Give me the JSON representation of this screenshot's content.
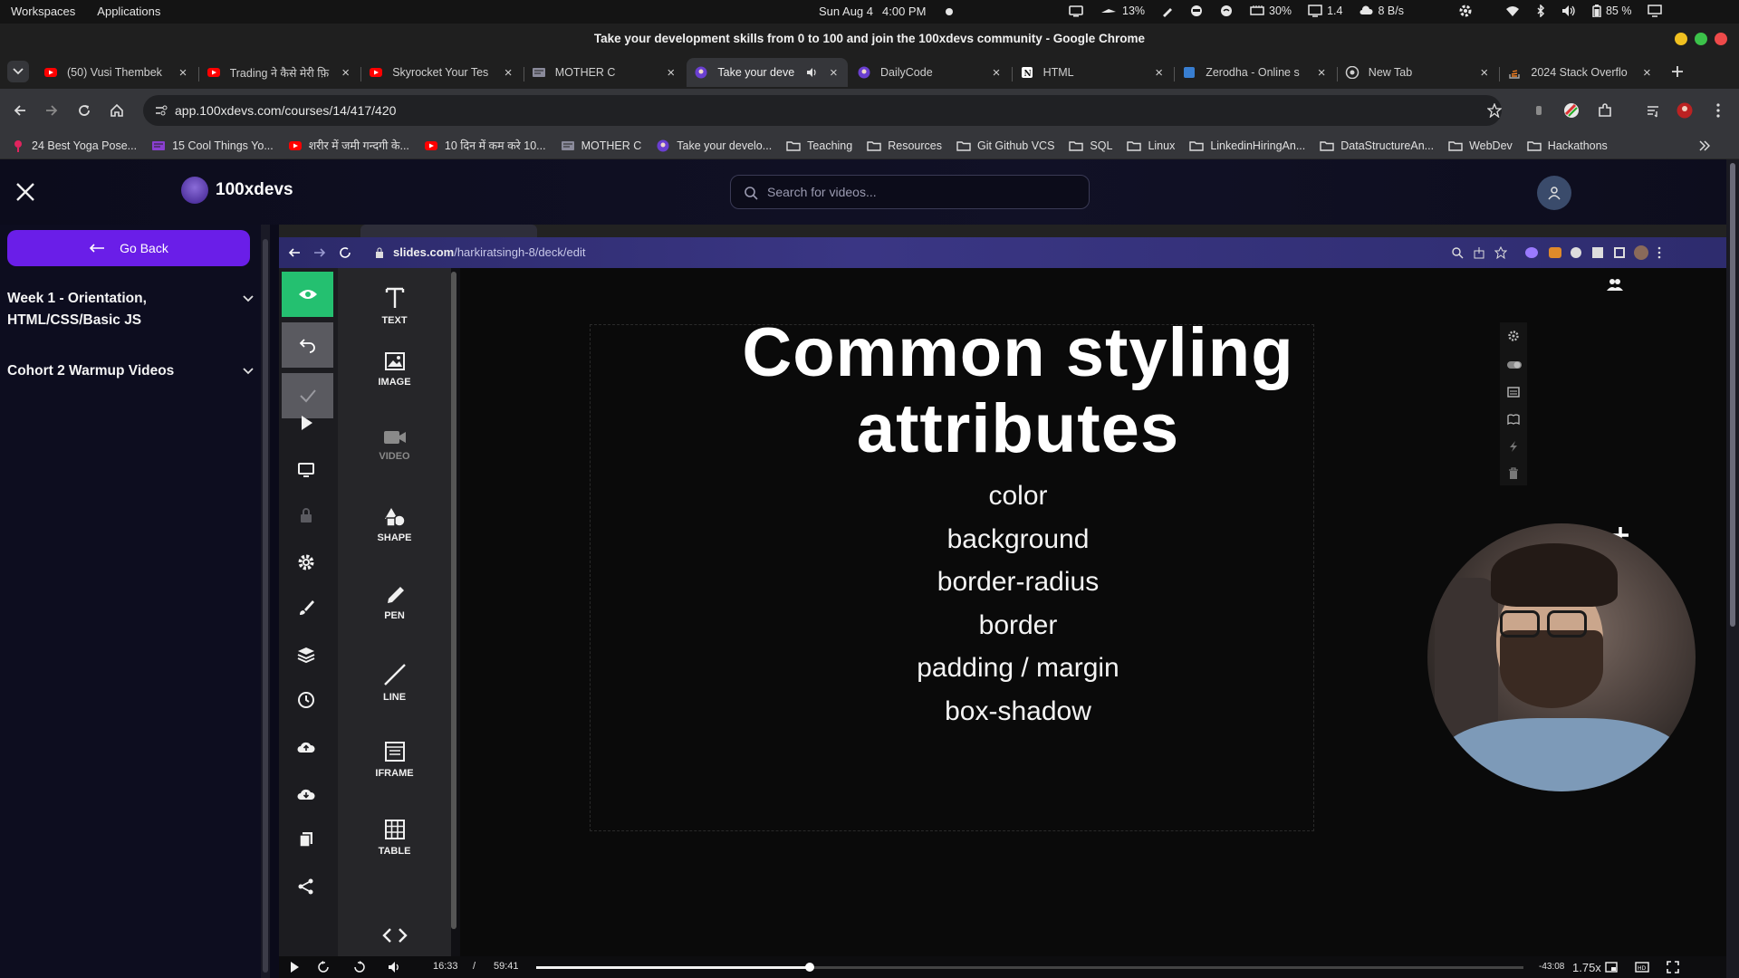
{
  "os": {
    "workspaces": "Workspaces",
    "applications": "Applications",
    "date": "Sun Aug 4",
    "time": "4:00 PM",
    "tray": {
      "cpu": "13%",
      "mem": "30%",
      "load": "1.4",
      "net": "8 B/s",
      "battery": "85 %"
    }
  },
  "window": {
    "title": "Take your development skills from 0 to 100 and join the 100xdevs community - Google Chrome"
  },
  "tabs": [
    {
      "label": "(50) Vusi Thembek",
      "favicon": "youtube-icon",
      "color": "#ff0000"
    },
    {
      "label": "Trading ने कैसे मेरी फ़ि",
      "favicon": "youtube-icon",
      "color": "#ff0000"
    },
    {
      "label": "Skyrocket Your Tes",
      "favicon": "youtube-icon",
      "color": "#ff0000"
    },
    {
      "label": "MOTHER C",
      "favicon": "page-icon",
      "color": "#8a8a9a"
    },
    {
      "label": "Take your deve",
      "favicon": "100xdevs-icon",
      "color": "#6a3fd0",
      "active": true
    },
    {
      "label": "DailyCode",
      "favicon": "100xdevs-icon",
      "color": "#6a3fd0"
    },
    {
      "label": "HTML",
      "favicon": "notion-icon",
      "color": "#ffffff"
    },
    {
      "label": "Zerodha - Online s",
      "favicon": "zerodha-icon",
      "color": "#387ed1"
    },
    {
      "label": "New Tab",
      "favicon": "chrome-icon",
      "color": "#cfcfcf"
    },
    {
      "label": "2024 Stack Overflo",
      "favicon": "stackoverflow-icon",
      "color": "#f48024"
    }
  ],
  "address": {
    "url": "app.100xdevs.com/courses/14/417/420"
  },
  "bookmarks": [
    {
      "label": "24 Best Yoga Pose...",
      "icon": "pin-icon",
      "color": "#e0245e"
    },
    {
      "label": "15 Cool Things Yo...",
      "icon": "page-icon",
      "color": "#8a3fd0"
    },
    {
      "label": "शरीर में जमी गन्दगी के...",
      "icon": "youtube-icon",
      "color": "#ff0000"
    },
    {
      "label": "10 दिन में कम करे 10...",
      "icon": "youtube-icon",
      "color": "#ff0000"
    },
    {
      "label": "MOTHER C",
      "icon": "page-icon",
      "color": "#8a8a9a"
    },
    {
      "label": "Take your develo...",
      "icon": "100xdevs-icon",
      "color": "#6a3fd0"
    },
    {
      "label": "Teaching",
      "icon": "folder-icon",
      "color": "#dcdcdc"
    },
    {
      "label": "Resources",
      "icon": "folder-icon",
      "color": "#dcdcdc"
    },
    {
      "label": "Git Github VCS",
      "icon": "folder-icon",
      "color": "#dcdcdc"
    },
    {
      "label": "SQL",
      "icon": "folder-icon",
      "color": "#dcdcdc"
    },
    {
      "label": "Linux",
      "icon": "folder-icon",
      "color": "#dcdcdc"
    },
    {
      "label": "LinkedinHiringAn...",
      "icon": "folder-icon",
      "color": "#dcdcdc"
    },
    {
      "label": "DataStructureAn...",
      "icon": "folder-icon",
      "color": "#dcdcdc"
    },
    {
      "label": "WebDev",
      "icon": "folder-icon",
      "color": "#dcdcdc"
    },
    {
      "label": "Hackathons",
      "icon": "folder-icon",
      "color": "#dcdcdc"
    }
  ],
  "app": {
    "brand": "100xdevs",
    "search_placeholder": "Search for videos...",
    "accent": "#6a1ee8"
  },
  "sidebar": {
    "go_back": "Go Back",
    "modules": [
      {
        "label": "Week 1 - Orientation, HTML/CSS/Basic JS"
      },
      {
        "label": "Cohort 2 Warmup Videos"
      }
    ]
  },
  "video": {
    "inner_url_domain": "slides.com",
    "inner_url_path": "/harkiratsingh-8/deck/edit",
    "tools": [
      "TEXT",
      "IMAGE",
      "VIDEO",
      "SHAPE",
      "PEN",
      "LINE",
      "IFRAME",
      "TABLE"
    ],
    "slide": {
      "title": "Common styling attributes",
      "items": [
        "color",
        "background",
        "border-radius",
        "border",
        "padding / margin",
        "box-shadow"
      ]
    },
    "player": {
      "current": "16:33",
      "separator": "/",
      "duration": "59:41",
      "remaining": "-43:08",
      "speed": "1.75x",
      "progress": 0.277
    }
  }
}
